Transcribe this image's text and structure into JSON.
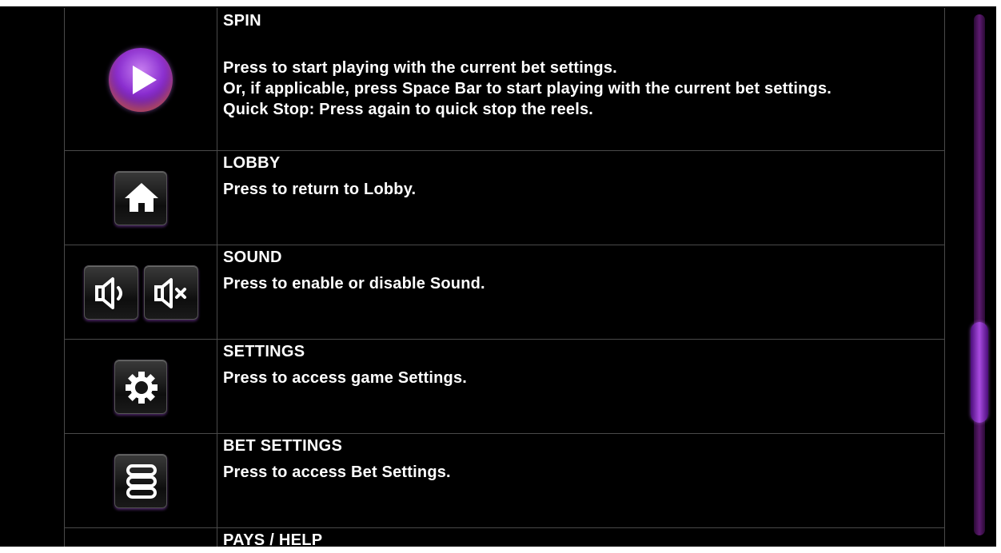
{
  "help": {
    "items": [
      {
        "title": "SPIN",
        "lines": [
          "Press to start playing with the current bet settings.",
          "Or, if applicable, press Space Bar to start playing with the current bet settings.",
          "Quick Stop: Press again to quick stop the reels."
        ],
        "icon": "play-icon"
      },
      {
        "title": "LOBBY",
        "lines": [
          "Press to return to Lobby."
        ],
        "icon": "home-icon"
      },
      {
        "title": "SOUND",
        "lines": [
          "Press to enable or disable Sound."
        ],
        "icons": [
          "speaker-on-icon",
          "speaker-mute-icon"
        ]
      },
      {
        "title": "SETTINGS",
        "lines": [
          "Press to access game Settings."
        ],
        "icon": "gear-icon"
      },
      {
        "title": "BET SETTINGS",
        "lines": [
          "Press to access Bet Settings."
        ],
        "icon": "coin-stack-icon"
      },
      {
        "title": "PAYS / HELP",
        "lines": []
      }
    ]
  },
  "scrollbar": {
    "position_fraction": 0.6
  },
  "colors": {
    "background": "#000000",
    "text": "#ffffff",
    "accent_purple": "#8a2ed0",
    "grid_line": "#4a4a4a"
  }
}
